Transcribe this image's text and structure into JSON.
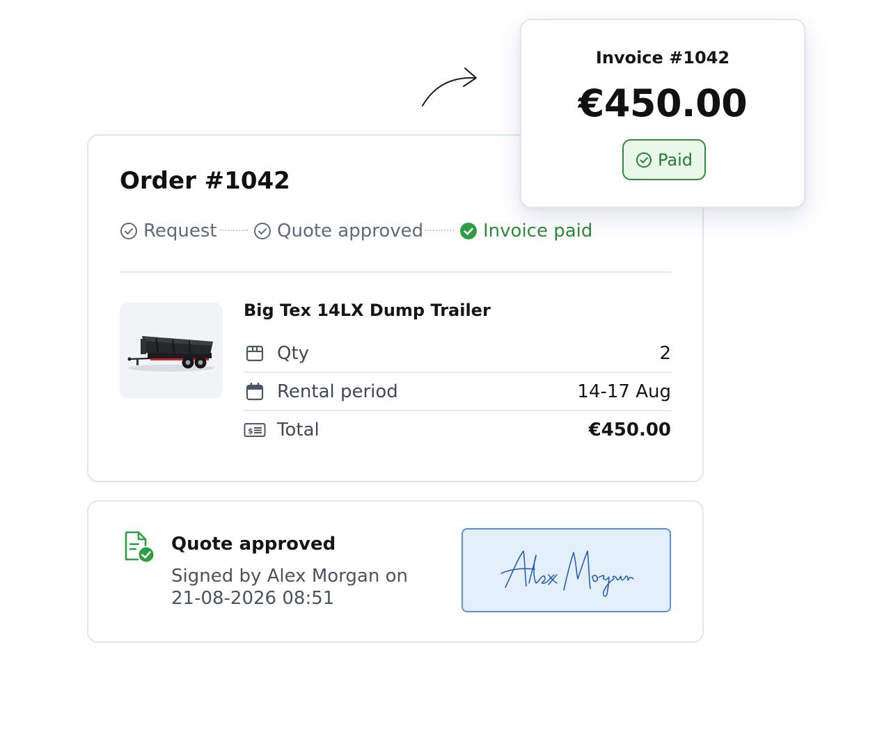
{
  "invoice": {
    "title": "Invoice #1042",
    "amount": "€450.00",
    "status": "Paid",
    "status_icon": "check-circle-icon"
  },
  "order": {
    "title": "Order #1042",
    "steps": [
      {
        "label": "Request",
        "state": "complete",
        "icon": "check-circle-outline-icon"
      },
      {
        "label": "Quote approved",
        "state": "complete",
        "icon": "check-circle-outline-icon"
      },
      {
        "label": "Invoice paid",
        "state": "current",
        "icon": "check-circle-filled-icon"
      }
    ],
    "item": {
      "name": "Big Tex 14LX Dump Trailer",
      "image": "dump-trailer-image",
      "rows": [
        {
          "icon": "box-icon",
          "label": "Qty",
          "value": "2"
        },
        {
          "icon": "calendar-icon",
          "label": "Rental period",
          "value": "14-17 Aug"
        },
        {
          "icon": "receipt-icon",
          "label": "Total",
          "value": "€450.00"
        }
      ]
    }
  },
  "quote": {
    "icon": "document-check-icon",
    "title": "Quote approved",
    "signed_line": "Signed by Alex Morgan on",
    "signed_date": "21-08-2026 08:51",
    "signature": "Alex Morgan"
  },
  "colors": {
    "success": "#2e8b3c",
    "muted": "#5d6a78",
    "signature_ink": "#1f55b8",
    "signature_bg": "#e4effc",
    "card_border": "#dfe6f1"
  }
}
